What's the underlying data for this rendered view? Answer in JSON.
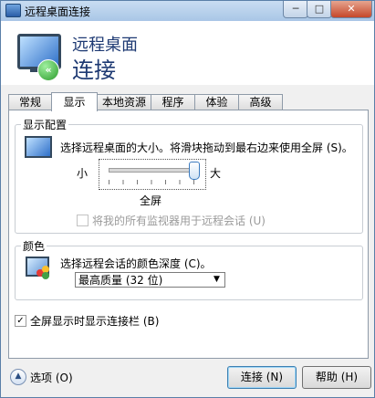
{
  "window": {
    "title": "远程桌面连接",
    "min_symbol": "─",
    "max_symbol": "□",
    "close_symbol": "✕"
  },
  "header": {
    "line1": "远程桌面",
    "line2": "连接",
    "icon": "remote-desktop-monitor-icon"
  },
  "tabs": [
    "常规",
    "显示",
    "本地资源",
    "程序",
    "体验",
    "高级"
  ],
  "active_tab": "显示",
  "display": {
    "group_label": "显示配置",
    "description": "选择远程桌面的大小。将滑块拖动到最右边来使用全屏 (S)。",
    "slider_min_label": "小",
    "slider_max_label": "大",
    "slider_value_label": "全屏",
    "slider_position": 1.0,
    "multi_monitor_label": "将我的所有监视器用于远程会话 (U)",
    "multi_monitor_checked": false,
    "multi_monitor_enabled": false
  },
  "color": {
    "group_label": "颜色",
    "description": "选择远程会话的颜色深度 (C)。",
    "selected": "最高质量 (32 位)",
    "dropdown_arrow": "▼"
  },
  "connection_bar": {
    "label": "全屏显示时显示连接栏 (B)",
    "checked": true,
    "check_mark": "✓"
  },
  "footer": {
    "options_label": "选项 (O)",
    "options_symbol": "▲",
    "connect_label": "连接 (N)",
    "help_label": "帮助 (H)"
  },
  "colors": {
    "header_text": "#1e3a73",
    "titlebar": "#b8d1ec",
    "close_button": "#c5472a"
  }
}
